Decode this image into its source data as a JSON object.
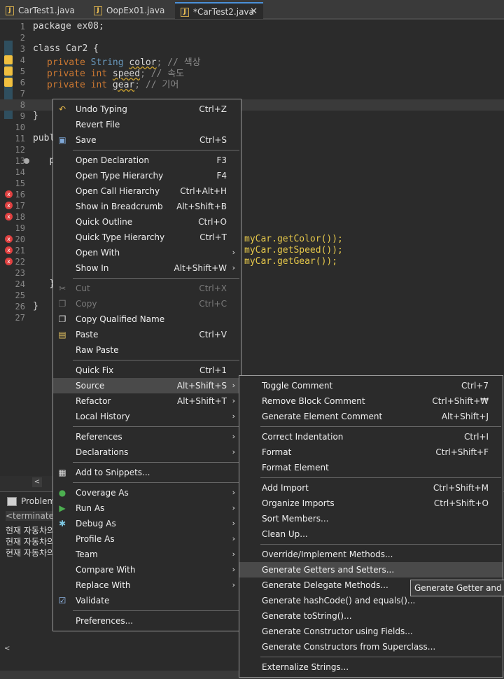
{
  "tabs": [
    {
      "label": "CarTest1.java",
      "active": false
    },
    {
      "label": "OopEx01.java",
      "active": false
    },
    {
      "label": "*CarTest2.java",
      "active": true
    }
  ],
  "code_lines": [
    {
      "num": "1",
      "text": "package ex08;"
    },
    {
      "num": "2",
      "text": ""
    },
    {
      "num": "3",
      "text": "class Car2 {"
    },
    {
      "num": "4",
      "kw": "private ",
      "ty": "String ",
      "name": "color",
      "cmt": "; // 색상"
    },
    {
      "num": "5",
      "kw": "private int ",
      "name": "speed",
      "cmt": "; // 속도"
    },
    {
      "num": "6",
      "kw": "private int ",
      "name": "gear",
      "cmt": "; // 기어"
    },
    {
      "num": "7",
      "text": ""
    },
    {
      "num": "8",
      "text": "    |"
    },
    {
      "num": "9",
      "text": "}"
    },
    {
      "num": "10",
      "text": ""
    },
    {
      "num": "11",
      "text": "publ"
    },
    {
      "num": "12",
      "text": ""
    },
    {
      "num": "13",
      "text": "   p"
    },
    {
      "num": "14",
      "text": ""
    },
    {
      "num": "15",
      "text": ""
    },
    {
      "num": "16",
      "text": ""
    },
    {
      "num": "17",
      "text": ""
    },
    {
      "num": "18",
      "text": ""
    },
    {
      "num": "19",
      "text": ""
    },
    {
      "num": "20",
      "text": "",
      "tail": "myCar.getColor());"
    },
    {
      "num": "21",
      "text": "",
      "tail": "myCar.getSpeed());"
    },
    {
      "num": "22",
      "text": "",
      "tail": "myCar.getGear());"
    },
    {
      "num": "23",
      "text": ""
    },
    {
      "num": "24",
      "text": "   }"
    },
    {
      "num": "25",
      "text": ""
    },
    {
      "num": "26",
      "text": "}"
    },
    {
      "num": "27",
      "text": ""
    }
  ],
  "panel": {
    "tab_label": "Problem",
    "terminated": "<terminated",
    "output": [
      "현재 자동차의",
      "현재 자동차의",
      "현재 자동차의"
    ]
  },
  "context_menu": [
    {
      "label": "Undo Typing",
      "shortcut": "Ctrl+Z",
      "icon": "undo-icon"
    },
    {
      "label": "Revert File"
    },
    {
      "label": "Save",
      "shortcut": "Ctrl+S",
      "icon": "save-icon"
    },
    {
      "sep": true
    },
    {
      "label": "Open Declaration",
      "shortcut": "F3"
    },
    {
      "label": "Open Type Hierarchy",
      "shortcut": "F4"
    },
    {
      "label": "Open Call Hierarchy",
      "shortcut": "Ctrl+Alt+H"
    },
    {
      "label": "Show in Breadcrumb",
      "shortcut": "Alt+Shift+B"
    },
    {
      "label": "Quick Outline",
      "shortcut": "Ctrl+O"
    },
    {
      "label": "Quick Type Hierarchy",
      "shortcut": "Ctrl+T"
    },
    {
      "label": "Open With",
      "arrow": true
    },
    {
      "label": "Show In",
      "shortcut": "Alt+Shift+W",
      "arrow": true
    },
    {
      "sep": true
    },
    {
      "label": "Cut",
      "shortcut": "Ctrl+X",
      "disabled": true,
      "icon": "cut-icon"
    },
    {
      "label": "Copy",
      "shortcut": "Ctrl+C",
      "disabled": true,
      "icon": "copy-icon"
    },
    {
      "label": "Copy Qualified Name",
      "icon": "copy-qualified-icon"
    },
    {
      "label": "Paste",
      "shortcut": "Ctrl+V",
      "icon": "paste-icon"
    },
    {
      "label": "Raw Paste"
    },
    {
      "sep": true
    },
    {
      "label": "Quick Fix",
      "shortcut": "Ctrl+1"
    },
    {
      "label": "Source",
      "shortcut": "Alt+Shift+S",
      "arrow": true,
      "highlight": true
    },
    {
      "label": "Refactor",
      "shortcut": "Alt+Shift+T",
      "arrow": true
    },
    {
      "label": "Local History",
      "arrow": true
    },
    {
      "sep": true
    },
    {
      "label": "References",
      "arrow": true
    },
    {
      "label": "Declarations",
      "arrow": true
    },
    {
      "sep": true
    },
    {
      "label": "Add to Snippets...",
      "icon": "snippets-icon"
    },
    {
      "sep": true
    },
    {
      "label": "Coverage As",
      "arrow": true,
      "icon": "coverage-icon"
    },
    {
      "label": "Run As",
      "arrow": true,
      "icon": "run-icon"
    },
    {
      "label": "Debug As",
      "arrow": true,
      "icon": "debug-icon"
    },
    {
      "label": "Profile As",
      "arrow": true
    },
    {
      "label": "Team",
      "arrow": true
    },
    {
      "label": "Compare With",
      "arrow": true
    },
    {
      "label": "Replace With",
      "arrow": true
    },
    {
      "label": "Validate",
      "icon": "checkbox-icon"
    },
    {
      "sep": true
    },
    {
      "label": "Preferences..."
    }
  ],
  "source_menu": [
    {
      "label": "Toggle Comment",
      "shortcut": "Ctrl+7"
    },
    {
      "label": "Remove Block Comment",
      "shortcut": "Ctrl+Shift+₩"
    },
    {
      "label": "Generate Element Comment",
      "shortcut": "Alt+Shift+J"
    },
    {
      "sep": true
    },
    {
      "label": "Correct Indentation",
      "shortcut": "Ctrl+I"
    },
    {
      "label": "Format",
      "shortcut": "Ctrl+Shift+F"
    },
    {
      "label": "Format Element"
    },
    {
      "sep": true
    },
    {
      "label": "Add Import",
      "shortcut": "Ctrl+Shift+M"
    },
    {
      "label": "Organize Imports",
      "shortcut": "Ctrl+Shift+O"
    },
    {
      "label": "Sort Members..."
    },
    {
      "label": "Clean Up..."
    },
    {
      "sep": true
    },
    {
      "label": "Override/Implement Methods..."
    },
    {
      "label": "Generate Getters and Setters...",
      "highlight": true
    },
    {
      "label": "Generate Delegate Methods..."
    },
    {
      "label": "Generate hashCode() and equals()..."
    },
    {
      "label": "Generate toString()..."
    },
    {
      "label": "Generate Constructor using Fields..."
    },
    {
      "label": "Generate Constructors from Superclass..."
    },
    {
      "sep": true
    },
    {
      "label": "Externalize Strings..."
    }
  ],
  "tooltip": "Generate Getter and Set"
}
